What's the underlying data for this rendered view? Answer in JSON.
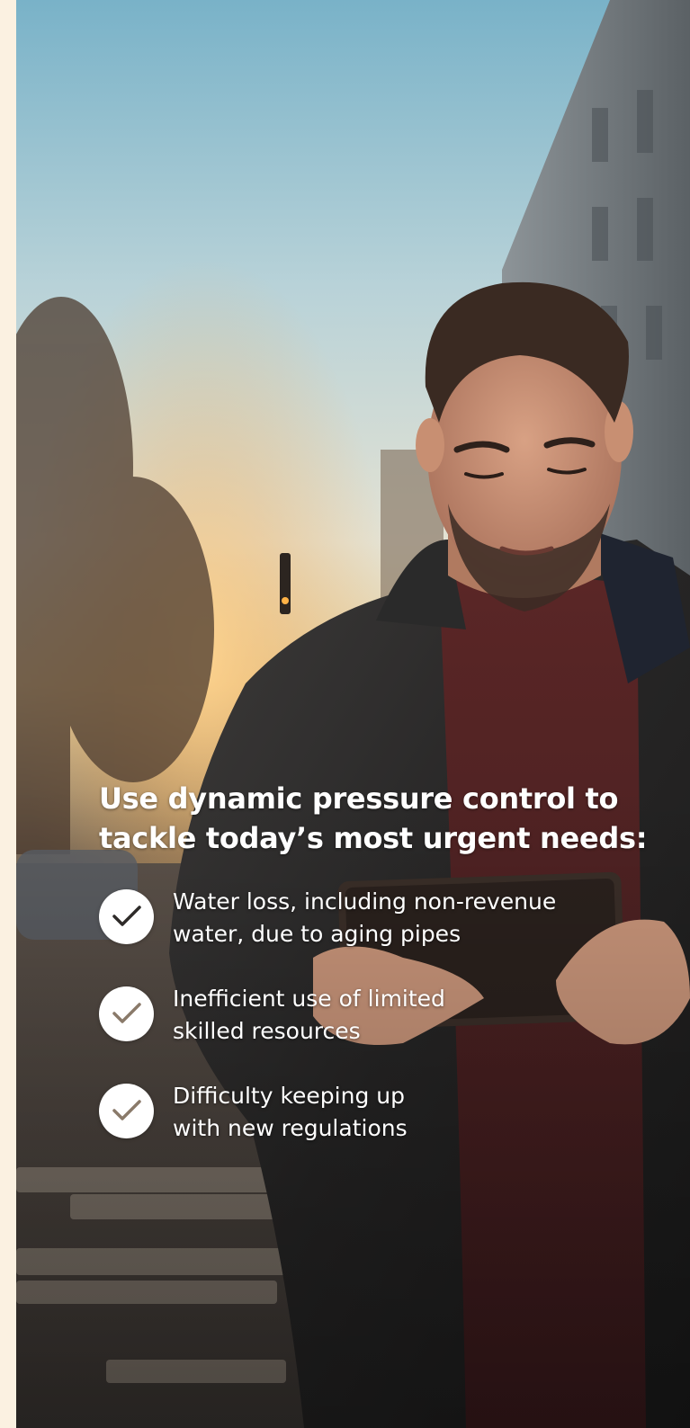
{
  "colors": {
    "margin_strip": "#fbf1e1",
    "text": "#ffffff",
    "check_badge": "#ffffff",
    "check_mark": "#2e2b29",
    "check_mark_faded": "#8a7a6a"
  },
  "headline": {
    "line1": "Use dynamic pressure control to",
    "line2": "tackle today’s most urgent needs:"
  },
  "needs": [
    {
      "line1": "Water loss, including non-revenue",
      "line2": "water, due to aging pipes",
      "icon": "checkmark-icon"
    },
    {
      "line1": "Inefficient use of limited",
      "line2": "skilled resources",
      "icon": "checkmark-icon"
    },
    {
      "line1": "Difficulty keeping up",
      "line2": "with new regulations",
      "icon": "checkmark-icon"
    }
  ]
}
